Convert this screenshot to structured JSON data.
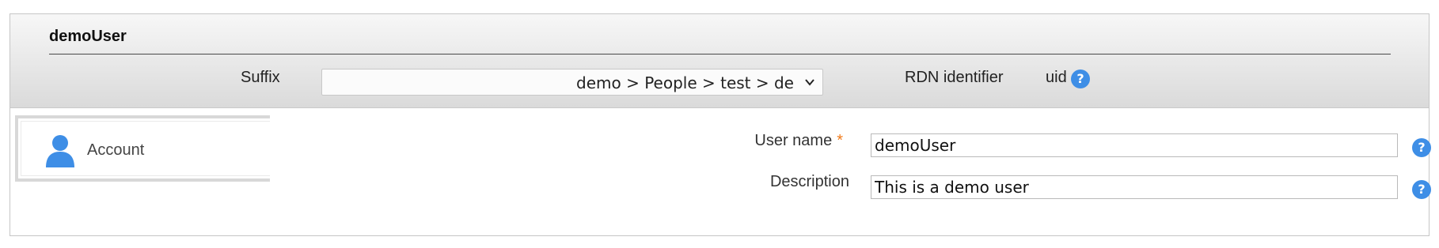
{
  "header": {
    "title": "demoUser",
    "suffix_label": "Suffix",
    "suffix_value": "demo > People > test > de",
    "rdn_label": "RDN identifier",
    "rdn_value": "uid",
    "help_glyph": "?"
  },
  "tabs": [
    {
      "label": "Account",
      "icon": "user-icon",
      "selected": true
    }
  ],
  "form": {
    "username": {
      "label": "User name",
      "required_marker": "*",
      "value": "demoUser"
    },
    "description": {
      "label": "Description",
      "value": "This is a demo user"
    }
  },
  "colors": {
    "help_icon": "#3e8ee6",
    "user_icon": "#3e8ee6",
    "required_star": "#f07a1a"
  }
}
